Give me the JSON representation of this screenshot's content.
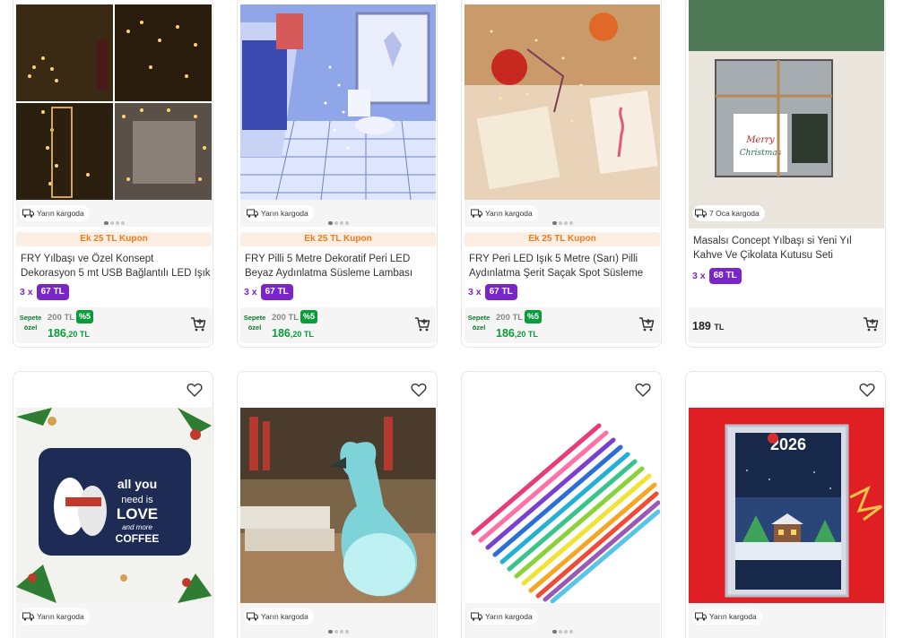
{
  "colors": {
    "accent_orange": "#f27a1a",
    "installment_purple": "#7a25c8",
    "discount_green": "#0a9b3a"
  },
  "products": [
    {
      "image_icon": "string-lights-decor-photo",
      "cargo": "Yarın kargoda",
      "coupon": "Ek 25 TL Kupon",
      "title": "FRY Yılbaşı ve Özel Konsept Dekorasyon 5 mt USB Bağlantılı LED Işık",
      "installment_prefix": "3 x",
      "installment_amount": "67 TL",
      "basket_special": "Sepete özel",
      "old_price": "200 TL",
      "discount": "%5",
      "new_price_int": "186",
      "new_price_dec": ",20 TL"
    },
    {
      "image_icon": "laptop-fairy-lights-photo",
      "cargo": "Yarın kargoda",
      "coupon": "Ek 25 TL Kupon",
      "title": "FRY Pilli 5 Metre Dekoratif Peri LED Beyaz Aydınlatma Süsleme Lambası",
      "installment_prefix": "3 x",
      "installment_amount": "67 TL",
      "basket_special": "Sepete özel",
      "old_price": "200 TL",
      "discount": "%5",
      "new_price_int": "186",
      "new_price_dec": ",20 TL"
    },
    {
      "image_icon": "flamingo-card-lights-photo",
      "cargo": "Yarın kargoda",
      "coupon": "Ek 25 TL Kupon",
      "title": "FRY Peri LED Işık 5 Metre (Sarı) Pilli Aydınlatma Şerit Saçak Spot Süsleme",
      "installment_prefix": "3 x",
      "installment_amount": "67 TL",
      "basket_special": "Sepete özel",
      "old_price": "200 TL",
      "discount": "%5",
      "new_price_int": "186",
      "new_price_dec": ",20 TL"
    },
    {
      "image_icon": "gift-box-photo",
      "cargo": "7 Oca kargoda",
      "title": "Masalsı Concept Yılbaşı si Yeni Yıl Kahve Ve Çikolata Kutusu Seti",
      "installment_prefix": "3 x",
      "installment_amount": "68 TL",
      "price_int": "189",
      "price_cur": "TL"
    },
    {
      "image_icon": "love-coffee-tray-photo",
      "cargo": "Yarın kargoda"
    },
    {
      "image_icon": "flamingo-lamp-photo",
      "cargo": "Yarın kargoda"
    },
    {
      "image_icon": "pipe-cleaners-photo",
      "cargo": "Yarın kargoda"
    },
    {
      "image_icon": "2026-calendar-photo",
      "cargo": "Yarın kargoda",
      "calendar_year": "2026"
    }
  ]
}
